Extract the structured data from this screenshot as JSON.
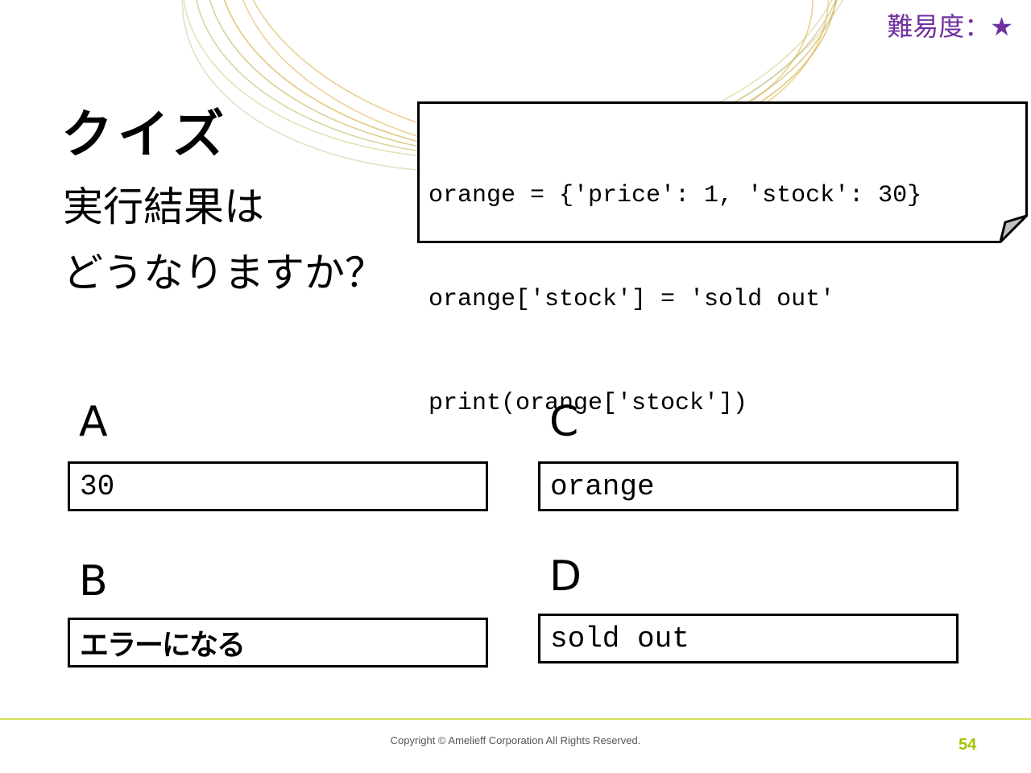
{
  "header": {
    "difficulty": "難易度：★"
  },
  "title": "クイズ",
  "question": {
    "line1": "実行結果は",
    "line2": "どうなりますか？"
  },
  "code": {
    "lines": [
      "orange = {'price': 1, 'stock': 30}",
      "orange['stock'] = 'sold out'",
      "print(orange['stock'])"
    ]
  },
  "options": {
    "a": {
      "letter": "A",
      "text": "30"
    },
    "b": {
      "letter": "B",
      "text": "エラーになる"
    },
    "c": {
      "letter": "C",
      "text": "orange"
    },
    "d": {
      "letter": "D",
      "text": "sold out"
    }
  },
  "footer": {
    "copyright": "Copyright © Amelieff Corporation All Rights Reserved.",
    "page": "54"
  },
  "colors": {
    "difficulty": "#7030a0",
    "footer_line": "#d4e157",
    "page_number": "#a4c400",
    "decor_rings": "#c8b44a"
  }
}
